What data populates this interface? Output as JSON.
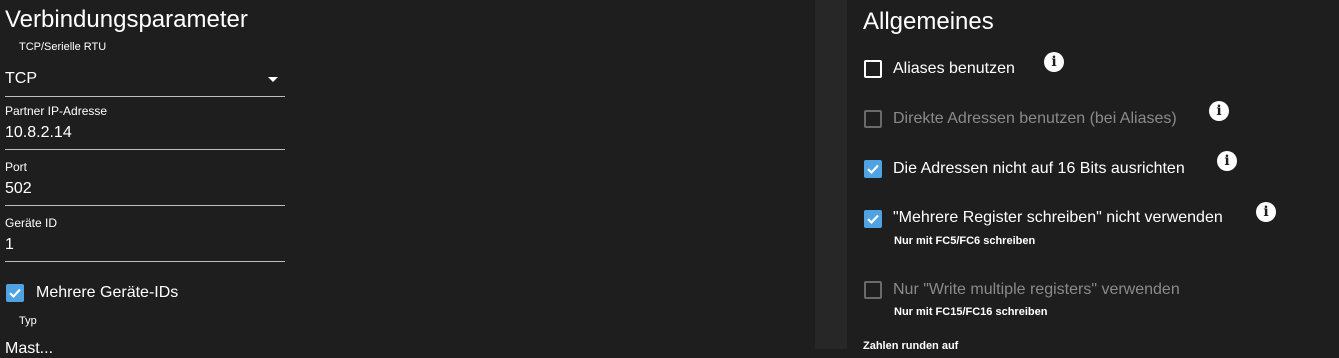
{
  "connection": {
    "title": "Verbindungsparameter",
    "mode_label": "TCP/Serielle RTU",
    "mode_value": "TCP",
    "partner_ip_label": "Partner IP-Adresse",
    "partner_ip_value": "10.8.2.14",
    "port_label": "Port",
    "port_value": "502",
    "device_id_label": "Geräte ID",
    "device_id_value": "1",
    "multiple_ids_label": "Mehrere Geräte-IDs",
    "multiple_ids_checked": true,
    "type_label": "Typ",
    "type_value_partial": "Mast..."
  },
  "general": {
    "title": "Allgemeines",
    "options": [
      {
        "label": "Aliases benutzen",
        "checked": false,
        "disabled": false
      },
      {
        "label": "Direkte Adressen benutzen (bei Aliases)",
        "checked": false,
        "disabled": true
      },
      {
        "label": "Die Adressen nicht auf 16 Bits ausrichten",
        "checked": true,
        "disabled": false
      },
      {
        "label": "\"Mehrere Register schreiben\" nicht verwenden",
        "checked": true,
        "disabled": false,
        "hint": "Nur mit FC5/FC6 schreiben"
      },
      {
        "label": "Nur \"Write multiple registers\" verwenden",
        "checked": false,
        "disabled": true,
        "hint": "Nur mit FC15/FC16 schreiben"
      }
    ],
    "round_label": "Zahlen runden auf"
  },
  "colors": {
    "background": "#1e1e1e",
    "accent": "#4fa3e3",
    "divider": "#272727"
  }
}
